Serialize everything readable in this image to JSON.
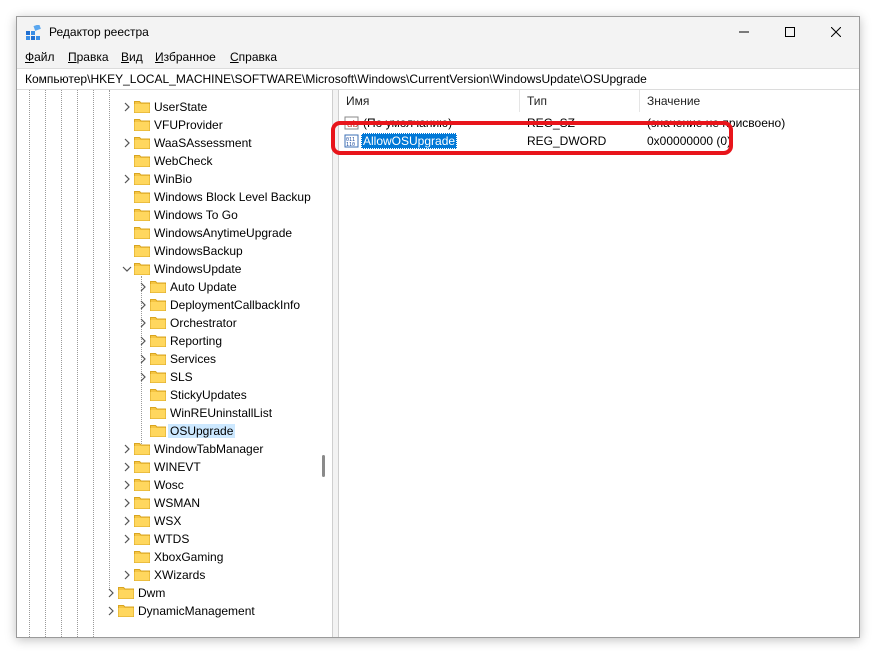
{
  "window": {
    "title": "Редактор реестра",
    "controls": {
      "minimize": "minimize",
      "maximize": "maximize",
      "close": "close"
    }
  },
  "menu": [
    {
      "label": "Файл",
      "accel": "Ф",
      "rest": "айл"
    },
    {
      "label": "Правка",
      "accel": "П",
      "rest": "равка"
    },
    {
      "label": "Вид",
      "accel": "В",
      "rest": "ид"
    },
    {
      "label": "Избранное",
      "accel": "И",
      "rest": "збранное"
    },
    {
      "label": "Справка",
      "accel": "С",
      "rest": "правка"
    }
  ],
  "address": "Компьютер\\HKEY_LOCAL_MACHINE\\SOFTWARE\\Microsoft\\Windows\\CurrentVersion\\WindowsUpdate\\OSUpgrade",
  "tree": [
    {
      "label": "UserState",
      "level": 2,
      "expander": "collapsed"
    },
    {
      "label": "VFUProvider",
      "level": 2,
      "expander": "none"
    },
    {
      "label": "WaaSAssessment",
      "level": 2,
      "expander": "collapsed"
    },
    {
      "label": "WebCheck",
      "level": 2,
      "expander": "none"
    },
    {
      "label": "WinBio",
      "level": 2,
      "expander": "collapsed"
    },
    {
      "label": "Windows Block Level Backup",
      "level": 2,
      "expander": "none"
    },
    {
      "label": "Windows To Go",
      "level": 2,
      "expander": "none"
    },
    {
      "label": "WindowsAnytimeUpgrade",
      "level": 2,
      "expander": "none"
    },
    {
      "label": "WindowsBackup",
      "level": 2,
      "expander": "none"
    },
    {
      "label": "WindowsUpdate",
      "level": 2,
      "expander": "expanded"
    },
    {
      "label": "Auto Update",
      "level": 3,
      "expander": "collapsed"
    },
    {
      "label": "DeploymentCallbackInfo",
      "level": 3,
      "expander": "collapsed"
    },
    {
      "label": "Orchestrator",
      "level": 3,
      "expander": "collapsed"
    },
    {
      "label": "Reporting",
      "level": 3,
      "expander": "collapsed"
    },
    {
      "label": "Services",
      "level": 3,
      "expander": "collapsed"
    },
    {
      "label": "SLS",
      "level": 3,
      "expander": "collapsed"
    },
    {
      "label": "StickyUpdates",
      "level": 3,
      "expander": "none"
    },
    {
      "label": "WinREUninstallList",
      "level": 3,
      "expander": "none"
    },
    {
      "label": "OSUpgrade",
      "level": 3,
      "expander": "none",
      "selected": true
    },
    {
      "label": "WindowTabManager",
      "level": 2,
      "expander": "collapsed"
    },
    {
      "label": "WINEVT",
      "level": 2,
      "expander": "collapsed"
    },
    {
      "label": "Wosc",
      "level": 2,
      "expander": "collapsed"
    },
    {
      "label": "WSMAN",
      "level": 2,
      "expander": "collapsed"
    },
    {
      "label": "WSX",
      "level": 2,
      "expander": "collapsed"
    },
    {
      "label": "WTDS",
      "level": 2,
      "expander": "collapsed"
    },
    {
      "label": "XboxGaming",
      "level": 2,
      "expander": "none"
    },
    {
      "label": "XWizards",
      "level": 2,
      "expander": "collapsed"
    },
    {
      "label": "Dwm",
      "level": 1,
      "expander": "collapsed"
    },
    {
      "label": "DynamicManagement",
      "level": 1,
      "expander": "collapsed"
    }
  ],
  "list": {
    "columns": {
      "name": "Имя",
      "type": "Тип",
      "data": "Значение"
    },
    "rows": [
      {
        "name": "(По умолчанию)",
        "type": "REG_SZ",
        "data": "(значение не присвоено)",
        "icon": "string-value-icon",
        "selected": false
      },
      {
        "name": "AllowOSUpgrade",
        "type": "REG_DWORD",
        "data": "0x00000000 (0)",
        "icon": "dword-value-icon",
        "selected": true
      }
    ]
  },
  "colors": {
    "highlight": "#e8151b",
    "selection": "#0078d7",
    "folder": "#f5c543"
  }
}
